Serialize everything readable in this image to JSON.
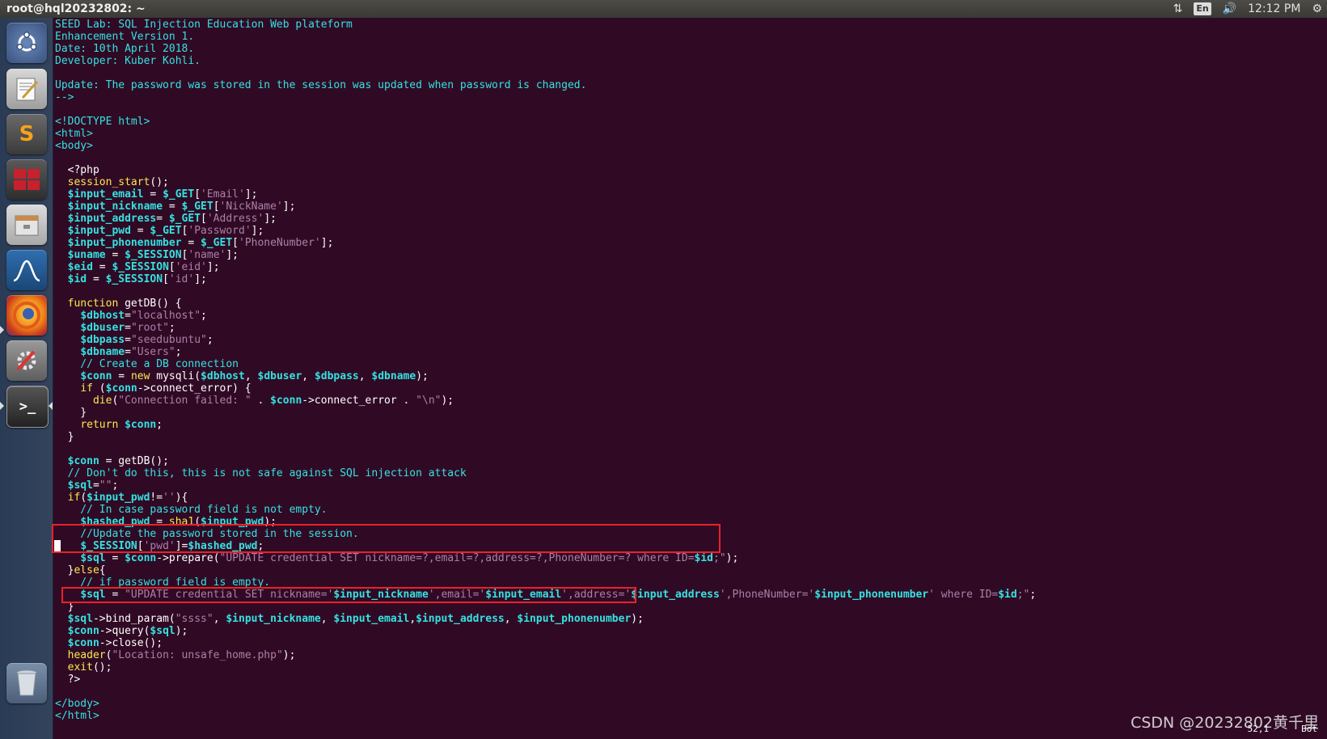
{
  "topbar": {
    "window_title": "root@hql20232802: ~",
    "keyboard_layout": "En",
    "clock": "12:12 PM"
  },
  "launcher": {
    "items": [
      {
        "name": "dash-home",
        "icon": "ubuntu-logo-icon"
      },
      {
        "name": "text-editor",
        "icon": "text-editor-icon"
      },
      {
        "name": "sublime-text",
        "icon": "sublime-text-icon",
        "glyph": "S"
      },
      {
        "name": "workspace-switcher",
        "icon": "workspace-switcher-icon"
      },
      {
        "name": "files",
        "icon": "file-manager-icon"
      },
      {
        "name": "wireshark",
        "icon": "wireshark-icon"
      },
      {
        "name": "firefox",
        "icon": "firefox-icon"
      },
      {
        "name": "system-settings",
        "icon": "settings-icon"
      },
      {
        "name": "terminal",
        "icon": "terminal-icon",
        "glyph": ">_"
      },
      {
        "name": "trash",
        "icon": "trash-icon"
      }
    ]
  },
  "colors": {
    "terminal_bg": "#300a24",
    "comment": "#34e2e2",
    "variable": "#34e2e2",
    "keyword": "#fce94f",
    "string": "#ad7fa8",
    "highlight_box": "#e8222b"
  },
  "code_lines": [
    [
      {
        "t": "SEED Lab: SQL Injection Education Web plateform",
        "c": "c"
      }
    ],
    [
      {
        "t": "Enhancement Version 1.",
        "c": "c"
      }
    ],
    [
      {
        "t": "Date: 10th April 2018.",
        "c": "c"
      }
    ],
    [
      {
        "t": "Developer: Kuber Kohli.",
        "c": "c"
      }
    ],
    [],
    [
      {
        "t": "Update: The password was stored in the session was updated when password is changed.",
        "c": "c"
      }
    ],
    [
      {
        "t": "-->",
        "c": "c"
      }
    ],
    [],
    [
      {
        "t": "<!DOCTYPE html>",
        "c": "c"
      }
    ],
    [
      {
        "t": "<html>",
        "c": "c"
      }
    ],
    [
      {
        "t": "<body>",
        "c": "c"
      }
    ],
    [],
    [
      {
        "t": "  <?php",
        "c": "p"
      }
    ],
    [
      {
        "t": "  ",
        "c": "p"
      },
      {
        "t": "session_start",
        "c": "k"
      },
      {
        "t": "();",
        "c": "p"
      }
    ],
    [
      {
        "t": "  ",
        "c": "p"
      },
      {
        "t": "$input_email",
        "c": "v"
      },
      {
        "t": " = ",
        "c": "p"
      },
      {
        "t": "$_GET",
        "c": "v"
      },
      {
        "t": "[",
        "c": "p"
      },
      {
        "t": "'Email'",
        "c": "s"
      },
      {
        "t": "];",
        "c": "p"
      }
    ],
    [
      {
        "t": "  ",
        "c": "p"
      },
      {
        "t": "$input_nickname",
        "c": "v"
      },
      {
        "t": " = ",
        "c": "p"
      },
      {
        "t": "$_GET",
        "c": "v"
      },
      {
        "t": "[",
        "c": "p"
      },
      {
        "t": "'NickName'",
        "c": "s"
      },
      {
        "t": "];",
        "c": "p"
      }
    ],
    [
      {
        "t": "  ",
        "c": "p"
      },
      {
        "t": "$input_address",
        "c": "v"
      },
      {
        "t": "= ",
        "c": "p"
      },
      {
        "t": "$_GET",
        "c": "v"
      },
      {
        "t": "[",
        "c": "p"
      },
      {
        "t": "'Address'",
        "c": "s"
      },
      {
        "t": "];",
        "c": "p"
      }
    ],
    [
      {
        "t": "  ",
        "c": "p"
      },
      {
        "t": "$input_pwd",
        "c": "v"
      },
      {
        "t": " = ",
        "c": "p"
      },
      {
        "t": "$_GET",
        "c": "v"
      },
      {
        "t": "[",
        "c": "p"
      },
      {
        "t": "'Password'",
        "c": "s"
      },
      {
        "t": "];",
        "c": "p"
      }
    ],
    [
      {
        "t": "  ",
        "c": "p"
      },
      {
        "t": "$input_phonenumber",
        "c": "v"
      },
      {
        "t": " = ",
        "c": "p"
      },
      {
        "t": "$_GET",
        "c": "v"
      },
      {
        "t": "[",
        "c": "p"
      },
      {
        "t": "'PhoneNumber'",
        "c": "s"
      },
      {
        "t": "];",
        "c": "p"
      }
    ],
    [
      {
        "t": "  ",
        "c": "p"
      },
      {
        "t": "$uname",
        "c": "v"
      },
      {
        "t": " = ",
        "c": "p"
      },
      {
        "t": "$_SESSION",
        "c": "v"
      },
      {
        "t": "[",
        "c": "p"
      },
      {
        "t": "'name'",
        "c": "s"
      },
      {
        "t": "];",
        "c": "p"
      }
    ],
    [
      {
        "t": "  ",
        "c": "p"
      },
      {
        "t": "$eid",
        "c": "v"
      },
      {
        "t": " = ",
        "c": "p"
      },
      {
        "t": "$_SESSION",
        "c": "v"
      },
      {
        "t": "[",
        "c": "p"
      },
      {
        "t": "'eid'",
        "c": "s"
      },
      {
        "t": "];",
        "c": "p"
      }
    ],
    [
      {
        "t": "  ",
        "c": "p"
      },
      {
        "t": "$id",
        "c": "v"
      },
      {
        "t": " = ",
        "c": "p"
      },
      {
        "t": "$_SESSION",
        "c": "v"
      },
      {
        "t": "[",
        "c": "p"
      },
      {
        "t": "'id'",
        "c": "s"
      },
      {
        "t": "];",
        "c": "p"
      }
    ],
    [],
    [
      {
        "t": "  ",
        "c": "p"
      },
      {
        "t": "function",
        "c": "k"
      },
      {
        "t": " getDB() {",
        "c": "p"
      }
    ],
    [
      {
        "t": "    ",
        "c": "p"
      },
      {
        "t": "$dbhost",
        "c": "v"
      },
      {
        "t": "=",
        "c": "p"
      },
      {
        "t": "\"localhost\"",
        "c": "s"
      },
      {
        "t": ";",
        "c": "p"
      }
    ],
    [
      {
        "t": "    ",
        "c": "p"
      },
      {
        "t": "$dbuser",
        "c": "v"
      },
      {
        "t": "=",
        "c": "p"
      },
      {
        "t": "\"root\"",
        "c": "s"
      },
      {
        "t": ";",
        "c": "p"
      }
    ],
    [
      {
        "t": "    ",
        "c": "p"
      },
      {
        "t": "$dbpass",
        "c": "v"
      },
      {
        "t": "=",
        "c": "p"
      },
      {
        "t": "\"seedubuntu\"",
        "c": "s"
      },
      {
        "t": ";",
        "c": "p"
      }
    ],
    [
      {
        "t": "    ",
        "c": "p"
      },
      {
        "t": "$dbname",
        "c": "v"
      },
      {
        "t": "=",
        "c": "p"
      },
      {
        "t": "\"Users\"",
        "c": "s"
      },
      {
        "t": ";",
        "c": "p"
      }
    ],
    [
      {
        "t": "    // Create a DB connection",
        "c": "c"
      }
    ],
    [
      {
        "t": "    ",
        "c": "p"
      },
      {
        "t": "$conn",
        "c": "v"
      },
      {
        "t": " = ",
        "c": "p"
      },
      {
        "t": "new",
        "c": "k"
      },
      {
        "t": " mysqli(",
        "c": "p"
      },
      {
        "t": "$dbhost",
        "c": "v"
      },
      {
        "t": ", ",
        "c": "p"
      },
      {
        "t": "$dbuser",
        "c": "v"
      },
      {
        "t": ", ",
        "c": "p"
      },
      {
        "t": "$dbpass",
        "c": "v"
      },
      {
        "t": ", ",
        "c": "p"
      },
      {
        "t": "$dbname",
        "c": "v"
      },
      {
        "t": ");",
        "c": "p"
      }
    ],
    [
      {
        "t": "    ",
        "c": "p"
      },
      {
        "t": "if",
        "c": "k"
      },
      {
        "t": " (",
        "c": "p"
      },
      {
        "t": "$conn",
        "c": "v"
      },
      {
        "t": "->connect_error) {",
        "c": "p"
      }
    ],
    [
      {
        "t": "      ",
        "c": "p"
      },
      {
        "t": "die",
        "c": "k"
      },
      {
        "t": "(",
        "c": "p"
      },
      {
        "t": "\"Connection failed: \"",
        "c": "s"
      },
      {
        "t": " . ",
        "c": "p"
      },
      {
        "t": "$conn",
        "c": "v"
      },
      {
        "t": "->connect_error . ",
        "c": "p"
      },
      {
        "t": "\"\\n\"",
        "c": "s"
      },
      {
        "t": ");",
        "c": "p"
      }
    ],
    [
      {
        "t": "    }",
        "c": "p"
      }
    ],
    [
      {
        "t": "    ",
        "c": "p"
      },
      {
        "t": "return",
        "c": "k"
      },
      {
        "t": " ",
        "c": "p"
      },
      {
        "t": "$conn",
        "c": "v"
      },
      {
        "t": ";",
        "c": "p"
      }
    ],
    [
      {
        "t": "  }",
        "c": "p"
      }
    ],
    [],
    [
      {
        "t": "  ",
        "c": "p"
      },
      {
        "t": "$conn",
        "c": "v"
      },
      {
        "t": " = getDB();",
        "c": "p"
      }
    ],
    [
      {
        "t": "  // Don't do this, this is not safe against SQL injection attack",
        "c": "c"
      }
    ],
    [
      {
        "t": "  ",
        "c": "p"
      },
      {
        "t": "$sql",
        "c": "v"
      },
      {
        "t": "=",
        "c": "p"
      },
      {
        "t": "\"\"",
        "c": "s"
      },
      {
        "t": ";",
        "c": "p"
      }
    ],
    [
      {
        "t": "  ",
        "c": "p"
      },
      {
        "t": "if",
        "c": "k"
      },
      {
        "t": "(",
        "c": "p"
      },
      {
        "t": "$input_pwd",
        "c": "v"
      },
      {
        "t": "!=",
        "c": "p"
      },
      {
        "t": "''",
        "c": "s"
      },
      {
        "t": "){",
        "c": "p"
      }
    ],
    [
      {
        "t": "    // In case password field is not empty.",
        "c": "c"
      }
    ],
    [
      {
        "t": "    ",
        "c": "p"
      },
      {
        "t": "$hashed_pwd",
        "c": "v"
      },
      {
        "t": " = ",
        "c": "p"
      },
      {
        "t": "sha1",
        "c": "k"
      },
      {
        "t": "(",
        "c": "p"
      },
      {
        "t": "$input_pwd",
        "c": "v"
      },
      {
        "t": ");",
        "c": "p"
      }
    ],
    [
      {
        "t": "    //Update the password stored in the session.",
        "c": "c"
      }
    ],
    [
      {
        "t": "    ",
        "c": "p"
      },
      {
        "t": "$_SESSION",
        "c": "v"
      },
      {
        "t": "[",
        "c": "p"
      },
      {
        "t": "'pwd'",
        "c": "s"
      },
      {
        "t": "]=",
        "c": "p"
      },
      {
        "t": "$hashed_pwd",
        "c": "v"
      },
      {
        "t": ";",
        "c": "p"
      }
    ],
    [
      {
        "t": "    ",
        "c": "p"
      },
      {
        "t": "$sql",
        "c": "v"
      },
      {
        "t": " = ",
        "c": "p"
      },
      {
        "t": "$conn",
        "c": "v"
      },
      {
        "t": "->prepare(",
        "c": "p"
      },
      {
        "t": "\"UPDATE credential SET nickname=?,email=?,address=?,PhoneNumber=? where ID=",
        "c": "s"
      },
      {
        "t": "$id",
        "c": "v"
      },
      {
        "t": ";\"",
        "c": "s"
      },
      {
        "t": ");",
        "c": "p"
      }
    ],
    [
      {
        "t": "  }",
        "c": "p"
      },
      {
        "t": "else",
        "c": "k"
      },
      {
        "t": "{",
        "c": "p"
      }
    ],
    [
      {
        "t": "    // if password field is empty.",
        "c": "c"
      }
    ],
    [
      {
        "t": "    ",
        "c": "p"
      },
      {
        "t": "$sql",
        "c": "v"
      },
      {
        "t": " = ",
        "c": "p"
      },
      {
        "t": "\"UPDATE credential SET nickname='",
        "c": "s"
      },
      {
        "t": "$input_nickname",
        "c": "v"
      },
      {
        "t": "',email='",
        "c": "s"
      },
      {
        "t": "$input_email",
        "c": "v"
      },
      {
        "t": "',address='",
        "c": "s"
      },
      {
        "t": "$input_address",
        "c": "v"
      },
      {
        "t": "',PhoneNumber='",
        "c": "s"
      },
      {
        "t": "$input_phonenumber",
        "c": "v"
      },
      {
        "t": "' where ID=",
        "c": "s"
      },
      {
        "t": "$id",
        "c": "v"
      },
      {
        "t": ";\"",
        "c": "s"
      },
      {
        "t": ";",
        "c": "p"
      }
    ],
    [
      {
        "t": "  }",
        "c": "p"
      }
    ],
    [
      {
        "t": "  ",
        "c": "p"
      },
      {
        "t": "$sql",
        "c": "v"
      },
      {
        "t": "->bind_param(",
        "c": "p"
      },
      {
        "t": "\"ssss\"",
        "c": "s"
      },
      {
        "t": ", ",
        "c": "p"
      },
      {
        "t": "$input_nickname",
        "c": "v"
      },
      {
        "t": ", ",
        "c": "p"
      },
      {
        "t": "$input_email",
        "c": "v"
      },
      {
        "t": ",",
        "c": "p"
      },
      {
        "t": "$input_address",
        "c": "v"
      },
      {
        "t": ", ",
        "c": "p"
      },
      {
        "t": "$input_phonenumber",
        "c": "v"
      },
      {
        "t": ");",
        "c": "p"
      }
    ],
    [
      {
        "t": "  ",
        "c": "p"
      },
      {
        "t": "$conn",
        "c": "v"
      },
      {
        "t": "->query(",
        "c": "p"
      },
      {
        "t": "$sql",
        "c": "v"
      },
      {
        "t": ");",
        "c": "p"
      }
    ],
    [
      {
        "t": "  ",
        "c": "p"
      },
      {
        "t": "$conn",
        "c": "v"
      },
      {
        "t": "->close();",
        "c": "p"
      }
    ],
    [
      {
        "t": "  ",
        "c": "p"
      },
      {
        "t": "header",
        "c": "k"
      },
      {
        "t": "(",
        "c": "p"
      },
      {
        "t": "\"Location: unsafe_home.php\"",
        "c": "s"
      },
      {
        "t": ");",
        "c": "p"
      }
    ],
    [
      {
        "t": "  ",
        "c": "p"
      },
      {
        "t": "exit",
        "c": "k"
      },
      {
        "t": "();",
        "c": "p"
      }
    ],
    [
      {
        "t": "  ?>",
        "c": "p"
      }
    ],
    [],
    [
      {
        "t": "</body>",
        "c": "c"
      }
    ],
    [
      {
        "t": "</html>",
        "c": "c"
      }
    ]
  ],
  "status": {
    "cursor_position": "52,1",
    "scroll_position": "Bot"
  },
  "watermark": "CSDN @20232802黄千里"
}
